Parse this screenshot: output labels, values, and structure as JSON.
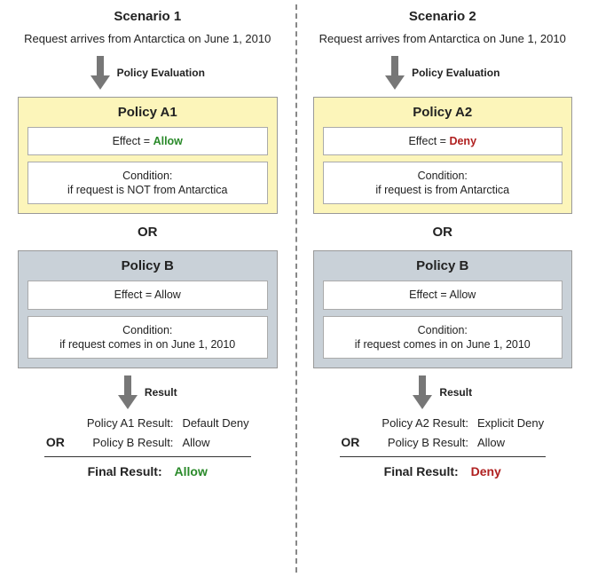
{
  "scenario1": {
    "title": "Scenario 1",
    "request": "Request arrives from Antarctica on June 1, 2010",
    "arrow1_label": "Policy Evaluation",
    "policyA": {
      "title": "Policy A1",
      "effect_prefix": "Effect = ",
      "effect_value": "Allow",
      "condition": "Condition:\nif request is NOT from Antarctica"
    },
    "or": "OR",
    "policyB": {
      "title": "Policy B",
      "effect_prefix": "Effect = ",
      "effect_value": "Allow",
      "condition": "Condition:\nif request comes in on June 1, 2010"
    },
    "arrow2_label": "Result",
    "results": {
      "rowA_label": "Policy A1 Result:",
      "rowA_value": "Default Deny",
      "or": "OR",
      "rowB_label": "Policy B Result:",
      "rowB_value": "Allow",
      "final_label": "Final Result:",
      "final_value": "Allow"
    }
  },
  "scenario2": {
    "title": "Scenario 2",
    "request": "Request arrives from Antarctica on June 1, 2010",
    "arrow1_label": "Policy Evaluation",
    "policyA": {
      "title": "Policy A2",
      "effect_prefix": "Effect = ",
      "effect_value": "Deny",
      "condition": "Condition:\nif request is from Antarctica"
    },
    "or": "OR",
    "policyB": {
      "title": "Policy B",
      "effect_prefix": "Effect = ",
      "effect_value": "Allow",
      "condition": "Condition:\nif request comes in on June 1, 2010"
    },
    "arrow2_label": "Result",
    "results": {
      "rowA_label": "Policy A2 Result:",
      "rowA_value": "Explicit Deny",
      "or": "OR",
      "rowB_label": "Policy B Result:",
      "rowB_value": "Allow",
      "final_label": "Final Result:",
      "final_value": "Deny"
    }
  }
}
